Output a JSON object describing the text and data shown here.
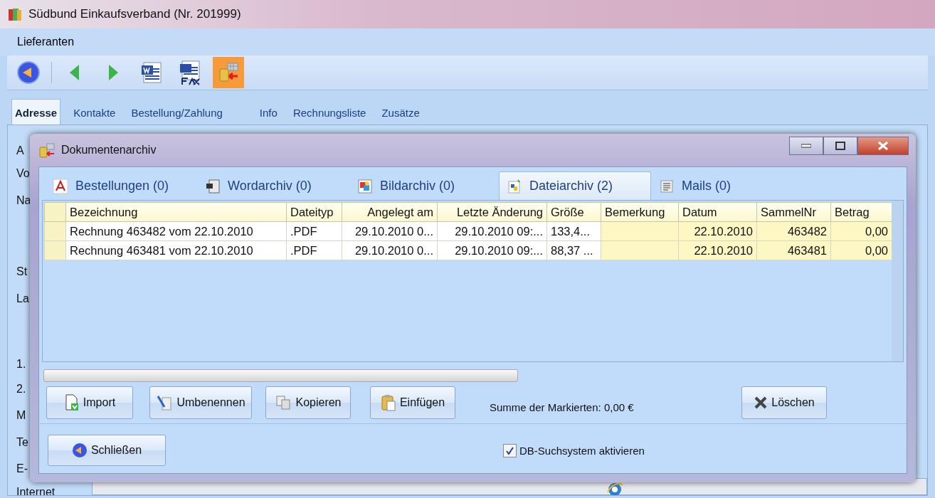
{
  "app_window": {
    "title": "Südbund Einkaufsverband  (Nr. 201999)",
    "menu": [
      "Lieferanten"
    ],
    "toolbar": [
      {
        "kind": "back",
        "active": false
      },
      {
        "kind": "prev",
        "active": false
      },
      {
        "kind": "next",
        "active": false
      },
      {
        "kind": "word",
        "active": false
      },
      {
        "kind": "fax",
        "active": false
      },
      {
        "kind": "archive",
        "active": true
      }
    ],
    "tabs": [
      {
        "label": "Adresse",
        "selected": true
      },
      {
        "label": "Kontakte",
        "selected": false
      },
      {
        "label": "Bestellung/Zahlung",
        "selected": false
      },
      {
        "label": "Info",
        "selected": false
      },
      {
        "label": "Rechnungsliste",
        "selected": false
      },
      {
        "label": "Zusätze",
        "selected": false
      }
    ],
    "form_labels": [
      "A",
      "Vo",
      "Na",
      "St",
      "La",
      "1.",
      "2.",
      "M",
      "Te",
      "E-",
      "Internet"
    ]
  },
  "dialog": {
    "title": "Dokumentenarchiv",
    "tabs": [
      {
        "label": "Bestellungen (0)",
        "kind": "pdf",
        "selected": false
      },
      {
        "label": "Wordarchiv (0)",
        "kind": "word",
        "selected": false
      },
      {
        "label": "Bildarchiv (0)",
        "kind": "image",
        "selected": false
      },
      {
        "label": "Dateiarchiv (2)",
        "kind": "file",
        "selected": true
      },
      {
        "label": "Mails (0)",
        "kind": "mail",
        "selected": false
      }
    ],
    "table": {
      "columns": [
        {
          "label": "Bezeichnung",
          "highlighted": false
        },
        {
          "label": "Dateityp",
          "highlighted": false
        },
        {
          "label": "Angelegt am",
          "highlighted": false
        },
        {
          "label": "Letzte Änderung",
          "highlighted": false
        },
        {
          "label": "Größe",
          "highlighted": false
        },
        {
          "label": "Bemerkung",
          "highlighted": true
        },
        {
          "label": "Datum",
          "highlighted": true
        },
        {
          "label": "SammelNr",
          "highlighted": true
        },
        {
          "label": "Betrag",
          "highlighted": true
        }
      ],
      "rows": [
        [
          "Rechnung 463482 vom 22.10.2010",
          ".PDF",
          "29.10.2010 0...",
          "29.10.2010 09:...",
          "133,4...",
          "",
          "22.10.2010",
          "463482",
          "0,00"
        ],
        [
          "Rechnung 463481 vom 22.10.2010",
          ".PDF",
          "29.10.2010 0...",
          "29.10.2010 09:...",
          "88,37 ...",
          "",
          "22.10.2010",
          "463481",
          "0,00"
        ]
      ]
    },
    "buttons": [
      {
        "label": "Import",
        "kind": "import"
      },
      {
        "label": "Umbenennen",
        "kind": "rename"
      },
      {
        "label": "Kopieren",
        "kind": "copy"
      },
      {
        "label": "Einfügen",
        "kind": "paste"
      }
    ],
    "sum_label": "Summe der Markierten: 0,00 €",
    "delete_button": "Löschen",
    "close_button": "Schließen",
    "db_search": {
      "label": "DB-Suchsystem aktivieren",
      "checked": true
    }
  }
}
